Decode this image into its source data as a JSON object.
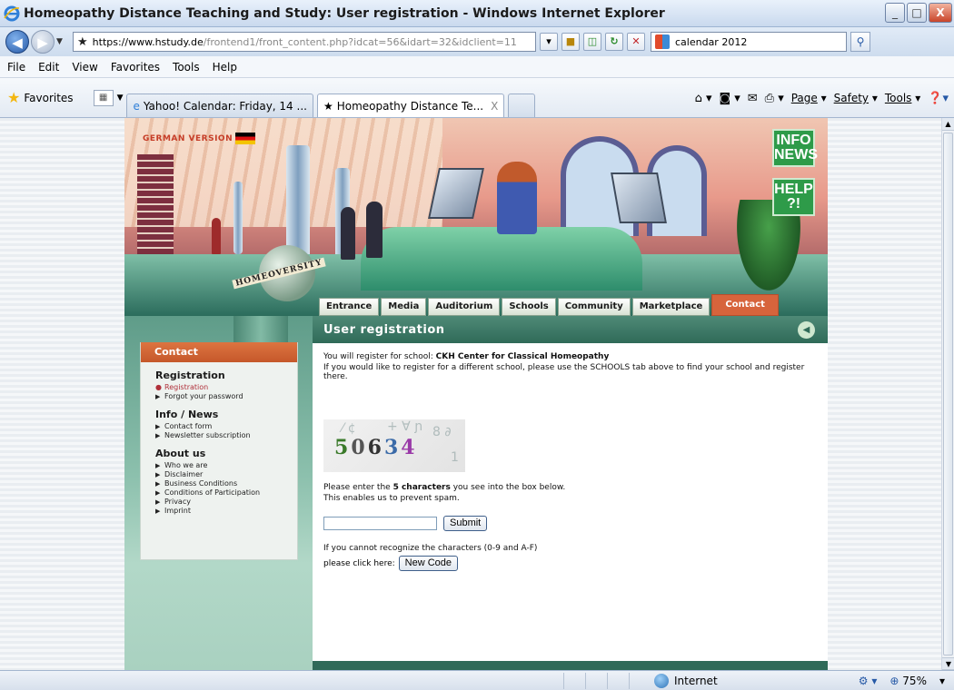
{
  "window": {
    "title": "Homeopathy Distance Teaching and Study: User registration - Windows Internet Explorer",
    "minimize": "_",
    "maximize": "□",
    "close": "X"
  },
  "address": {
    "url_https": "https://",
    "url_host": "www.hstudy.de",
    "url_rest": "/frontend1/front_content.php?idcat=56&idart=32&idclient=11",
    "search_value": "calendar 2012"
  },
  "menu": [
    "File",
    "Edit",
    "View",
    "Favorites",
    "Tools",
    "Help"
  ],
  "favbar": {
    "favorites_label": "Favorites",
    "tabs": [
      {
        "label": "Yahoo! Calendar: Friday, 14 ..."
      },
      {
        "label": "Homeopathy Distance Te...",
        "close": "X"
      }
    ],
    "commands": [
      "Page",
      "Safety",
      "Tools"
    ]
  },
  "site": {
    "german_version": "GERMAN VERSION",
    "globe_label": "HOMEOVERSITY",
    "info_news": [
      "INFO",
      "NEWS"
    ],
    "help": [
      "HELP",
      "?!"
    ],
    "nav_tabs": [
      "Entrance",
      "Media",
      "Auditorium",
      "Schools",
      "Community",
      "Marketplace",
      "Contact"
    ],
    "page_heading": "User registration",
    "sidebar": {
      "head": "Contact",
      "sections": [
        {
          "title": "Registration",
          "items": [
            "Registration",
            "Forgot your password"
          ]
        },
        {
          "title": "Info / News",
          "items": [
            "Contact form",
            "Newsletter subscription"
          ]
        },
        {
          "title": "About us",
          "items": [
            "Who we are",
            "Disclaimer",
            "Business Conditions",
            "Conditions of Participation",
            "Privacy",
            "Imprint"
          ]
        }
      ]
    },
    "main": {
      "register_prefix": "You will register for school: ",
      "school_name": "CKH Center for Classical Homeopathy",
      "different_school": "If you would like to register for a different school, please use the SCHOOLS tab above to find your school and register there.",
      "captcha_digits": [
        "5",
        "0",
        "6",
        "3",
        "4"
      ],
      "enter_prefix": "Please enter the ",
      "enter_bold": "5 characters",
      "enter_suffix": " you see into the box below.",
      "spam": "This enables us to prevent spam.",
      "submit": "Submit",
      "cannot_recognize": "If you cannot recognize the characters (0-9 and A-F)",
      "click_here": "please click here:",
      "new_code": "New Code"
    }
  },
  "status": {
    "zone": "Internet",
    "zoom": "75%"
  }
}
